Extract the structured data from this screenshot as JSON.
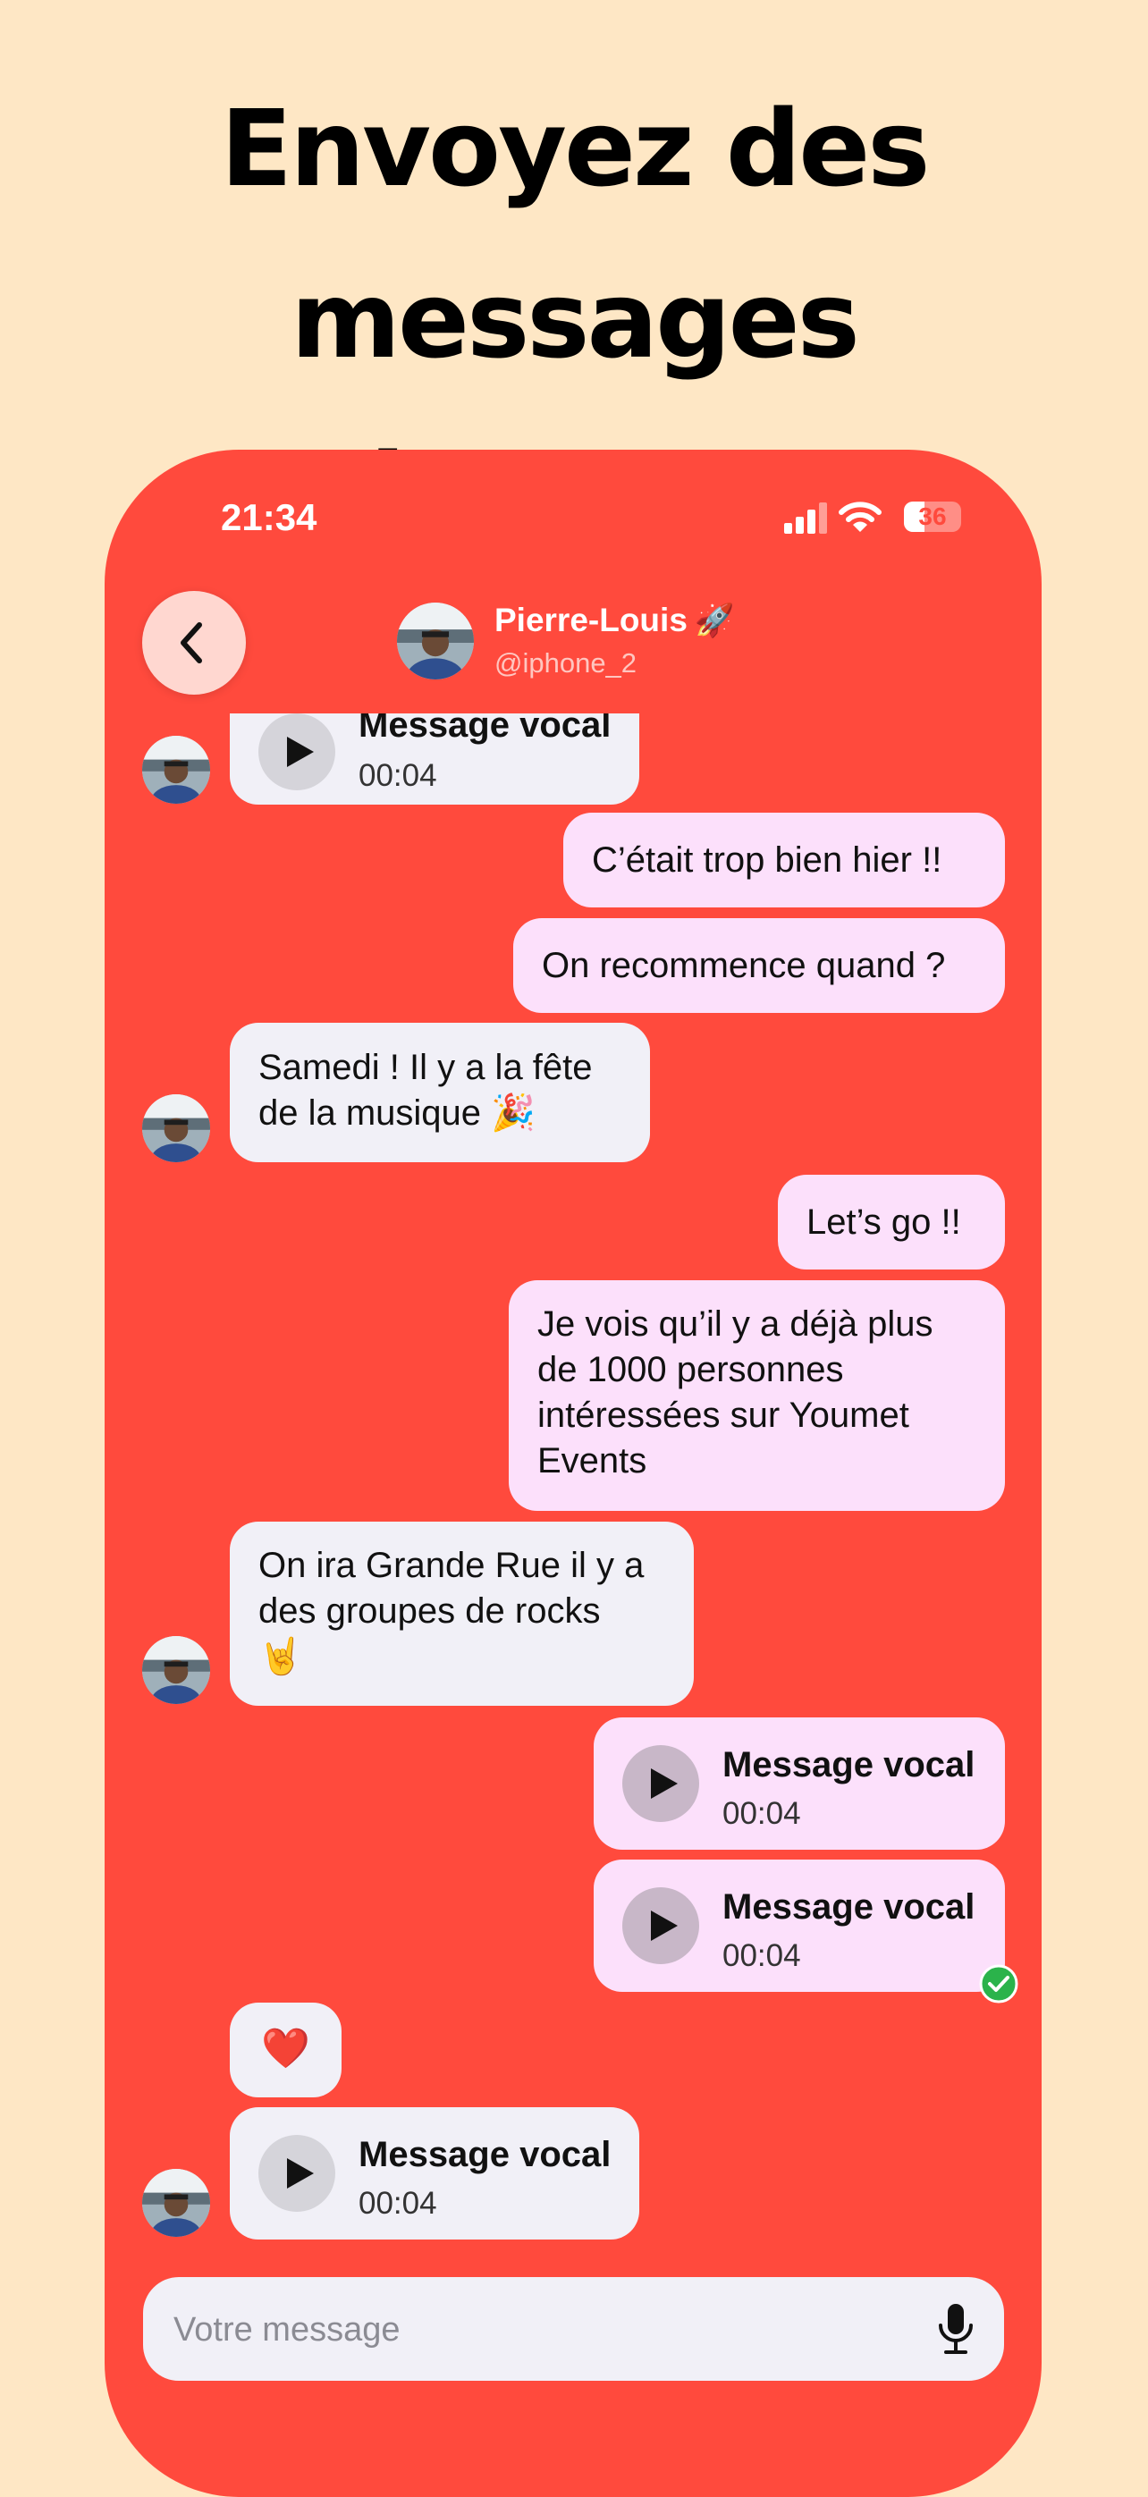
{
  "headline": {
    "line1": "Envoyez des messages",
    "line2": "et des vocaux"
  },
  "status_bar": {
    "time": "21:34",
    "battery": "36"
  },
  "header": {
    "name": "Pierre-Louis",
    "emoji": "🚀",
    "handle": "@iphone_2"
  },
  "messages": [
    {
      "side": "in",
      "type": "voice",
      "title": "Message vocal",
      "duration": "00:04"
    },
    {
      "side": "out",
      "type": "text",
      "text": "C’était trop bien hier !!"
    },
    {
      "side": "out",
      "type": "text",
      "text": "On recommence quand ?"
    },
    {
      "side": "in",
      "type": "text",
      "line1": "Samedi ! Il y a la fête",
      "line2": "de la musique 🎉"
    },
    {
      "side": "out",
      "type": "text",
      "text": "Let’s go !!"
    },
    {
      "side": "out",
      "type": "text",
      "line1": "Je vois qu’il y a déjà plus",
      "line2": "de 1000 personnes",
      "line3": "intéressées sur Youmet",
      "line4": "Events"
    },
    {
      "side": "in",
      "type": "text",
      "line1": "On ira Grande Rue il y a",
      "line2": "des groupes de rocks",
      "line3": "🤘"
    },
    {
      "side": "out",
      "type": "voice",
      "title": "Message vocal",
      "duration": "00:04"
    },
    {
      "side": "out",
      "type": "voice",
      "title": "Message vocal",
      "duration": "00:04",
      "status": "read"
    },
    {
      "side": "in",
      "type": "text",
      "text": "❤️"
    },
    {
      "side": "in",
      "type": "voice",
      "title": "Message vocal",
      "duration": "00:04"
    }
  ],
  "composer": {
    "placeholder": "Votre message"
  },
  "colors": {
    "background": "#FEE7C5",
    "phone": "#FF4A3D",
    "incoming": "#F1F0F7",
    "outgoing": "#FCE0FB",
    "read_check": "#2BB34B"
  },
  "icons": [
    "chevron-left-icon",
    "signal-icon",
    "wifi-icon",
    "battery-icon",
    "play-icon",
    "check-circle-icon",
    "microphone-icon"
  ]
}
